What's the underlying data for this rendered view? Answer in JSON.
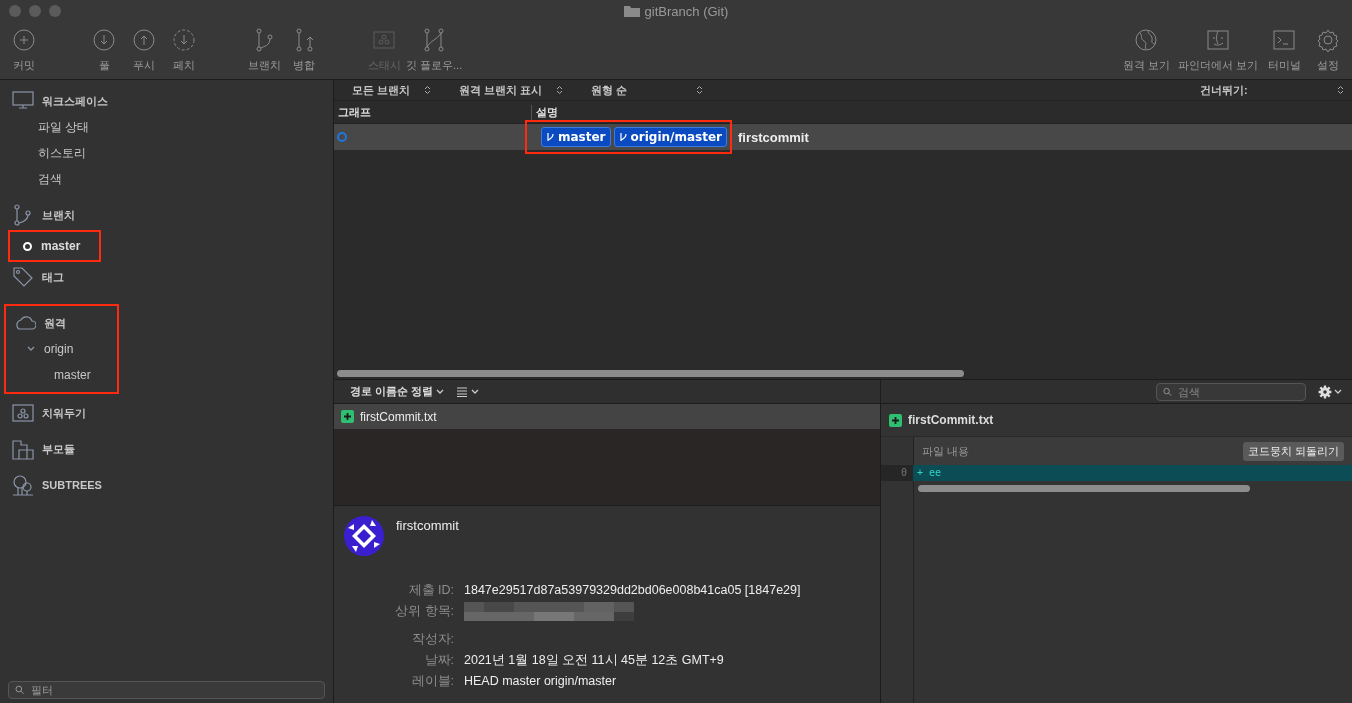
{
  "window": {
    "title": "gitBranch (Git)"
  },
  "toolbar": {
    "left_groups": [
      [
        {
          "label": "커밋",
          "kind": "commit",
          "disabled": false
        }
      ],
      [
        {
          "label": "풀",
          "kind": "pull",
          "disabled": false
        },
        {
          "label": "푸시",
          "kind": "push",
          "disabled": false
        },
        {
          "label": "페치",
          "kind": "fetch",
          "disabled": false
        }
      ],
      [
        {
          "label": "브랜치",
          "kind": "branch",
          "disabled": false
        },
        {
          "label": "병합",
          "kind": "merge",
          "disabled": false
        }
      ],
      [
        {
          "label": "스태시",
          "kind": "stash",
          "disabled": true
        },
        {
          "label": "깃 플로우...",
          "kind": "flow",
          "disabled": false
        }
      ]
    ],
    "right": [
      {
        "label": "원격 보기",
        "kind": "globe",
        "disabled": false
      },
      {
        "label": "파인더에서 보기",
        "kind": "finder",
        "disabled": false
      },
      {
        "label": "터미널",
        "kind": "terminal",
        "disabled": false
      },
      {
        "label": "설정",
        "kind": "gear",
        "disabled": false
      }
    ]
  },
  "sidebar": {
    "sections": [
      {
        "label": "워크스페이스",
        "kind": "workspace",
        "children": [
          {
            "label": "파일 상태"
          },
          {
            "label": "히스토리"
          },
          {
            "label": "검색"
          }
        ]
      },
      {
        "label": "브랜치",
        "kind": "branch"
      },
      {
        "label": "master",
        "kind": "current-branch",
        "highlighted": true
      },
      {
        "label": "태그",
        "kind": "tag"
      },
      {
        "label": "원격",
        "kind": "remote",
        "highlighted": true,
        "remotes": [
          {
            "label": "origin",
            "expanded": true,
            "children": [
              {
                "label": "master"
              }
            ]
          }
        ]
      },
      {
        "label": "치워두기",
        "kind": "stash"
      },
      {
        "label": "부모듈",
        "kind": "submodule"
      },
      {
        "label": "SUBTREES",
        "kind": "subtree"
      }
    ],
    "filter": {
      "placeholder": "필터"
    }
  },
  "history": {
    "filters": [
      "모든 브랜치",
      "원격 브랜치 표시",
      "원형 순"
    ],
    "jump": "건너뛰기:",
    "columns": [
      "그래프",
      "설명"
    ],
    "rows": [
      {
        "selected": true,
        "refs": [
          "master",
          "origin/master"
        ],
        "refs_highlighted": true,
        "message": "firstcommit"
      }
    ]
  },
  "files": {
    "sort": "경로 이름순 정렬",
    "search": {
      "placeholder": "검색"
    },
    "items": [
      {
        "name": "firstCommit.txt",
        "added": true,
        "selected": true
      }
    ]
  },
  "commit": {
    "message": "firstcommit",
    "fields": [
      {
        "label": "제출 ID:",
        "value": "1847e29517d87a53979329dd2bd06e008b41ca05 [1847e29]"
      },
      {
        "label": "상위 항목:",
        "redacted": true
      },
      {
        "label": "작성자:"
      },
      {
        "label": "날짜:",
        "value": "2021년 1월 18일 오전 11시 45분 12초 GMT+9"
      },
      {
        "label": "레이블:",
        "value": "HEAD master origin/master"
      }
    ]
  },
  "diff": {
    "file": "firstCommit.txt",
    "added": true,
    "hunk": "파일 내용",
    "revert": "코드뭉치 되돌리기",
    "lines": [
      {
        "number": "0",
        "sign": "+",
        "text": "ee",
        "kind": "added"
      }
    ]
  }
}
